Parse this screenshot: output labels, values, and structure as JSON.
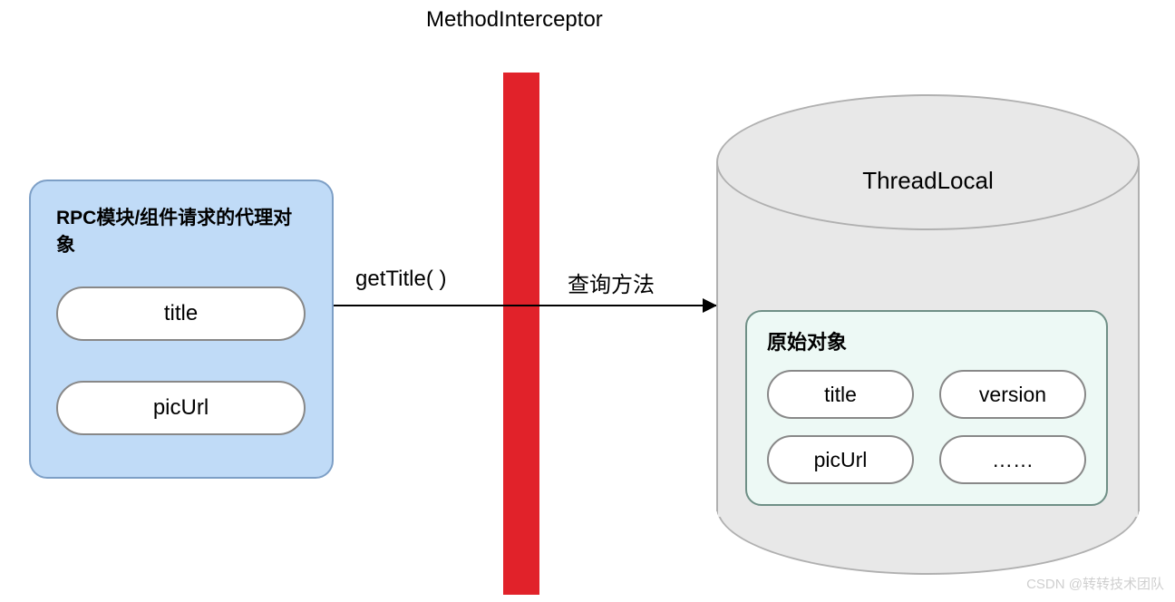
{
  "topLabel": "MethodInterceptor",
  "proxy": {
    "title": "RPC模块/组件请求的代理对象",
    "fields": [
      "title",
      "picUrl"
    ]
  },
  "arrow": {
    "leftLabel": "getTitle( )",
    "rightLabel": "查询方法"
  },
  "cylinder": {
    "label": "ThreadLocal",
    "orig": {
      "title": "原始对象",
      "fields": [
        "title",
        "version",
        "picUrl",
        "……"
      ]
    }
  },
  "watermark": "CSDN @转转技术团队"
}
